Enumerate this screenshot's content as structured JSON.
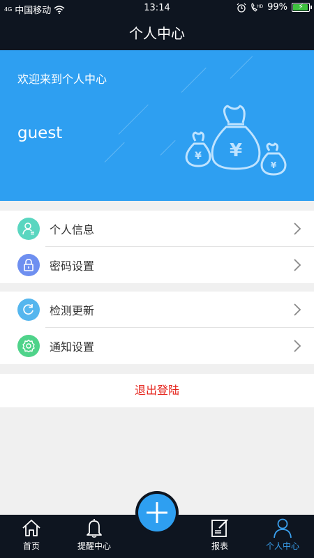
{
  "status_bar": {
    "carrier": "中国移动",
    "signal": "4G",
    "time": "13:14",
    "battery": "99%",
    "battery_level": 0.99
  },
  "header": {
    "title": "个人中心"
  },
  "hero": {
    "welcome": "欢迎来到个人中心",
    "username": "guest",
    "bag_symbol": "¥"
  },
  "menu_group_1": [
    {
      "label": "个人信息",
      "icon": "user-card-icon",
      "color": "#5ad6c0"
    },
    {
      "label": "密码设置",
      "icon": "lock-icon",
      "color": "#6e8ff0"
    }
  ],
  "menu_group_2": [
    {
      "label": "检测更新",
      "icon": "refresh-icon",
      "color": "#55b6ee"
    },
    {
      "label": "通知设置",
      "icon": "gear-icon",
      "color": "#4fd38a"
    }
  ],
  "logout_label": "退出登陆",
  "tabs": [
    {
      "label": "首页",
      "icon": "home-icon"
    },
    {
      "label": "提醒中心",
      "icon": "bell-icon"
    },
    {
      "label": "报表",
      "icon": "report-icon"
    },
    {
      "label": "个人中心",
      "icon": "person-icon",
      "active": true
    }
  ],
  "colors": {
    "accent": "#2e9ff1",
    "dark": "#0e1520",
    "logout": "#e5231b"
  }
}
